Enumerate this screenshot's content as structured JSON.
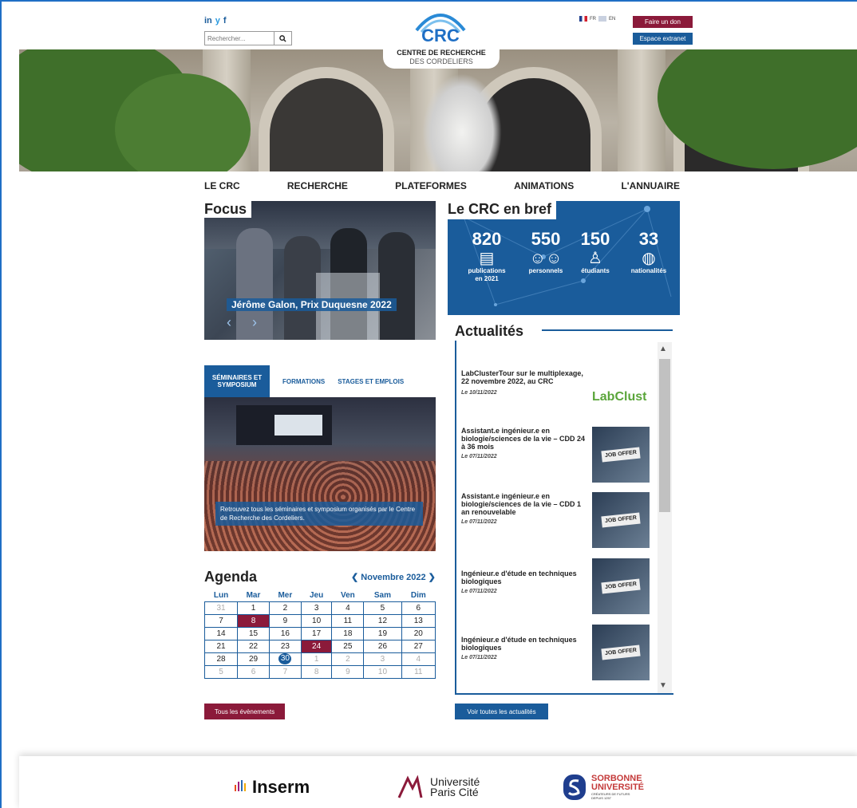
{
  "header": {
    "social": [
      "in",
      "y",
      "f"
    ],
    "search_placeholder": "Rechercher...",
    "logo_acronym": "CRC",
    "logo_line1": "CENTRE DE RECHERCHE",
    "logo_line2": "DES CORDELIERS",
    "lang_fr": "FR",
    "lang_en": "EN",
    "donate_label": "Faire un don",
    "extranet_label": "Espace extranet"
  },
  "nav": [
    "LE CRC",
    "RECHERCHE",
    "PLATEFORMES",
    "ANIMATIONS",
    "L'ANNUAIRE"
  ],
  "focus": {
    "title": "Focus",
    "caption": "Jérôme Galon, Prix Duquesne 2022",
    "prev": "‹",
    "next": "›"
  },
  "bref": {
    "title": "Le CRC en bref",
    "stats": [
      {
        "number": "820",
        "label": "publications en 2021",
        "icon": "document-icon"
      },
      {
        "number": "550",
        "label": "personnels",
        "icon": "people-icon"
      },
      {
        "number": "150",
        "label": "étudiants",
        "icon": "student-icon"
      },
      {
        "number": "33",
        "label": "nationalités",
        "icon": "globe-icon"
      }
    ]
  },
  "tabs": {
    "active": "SÉMINAIRES ET SYMPOSIUM",
    "t2": "FORMATIONS",
    "t3": "STAGES ET EMPLOIS",
    "caption": "Retrouvez tous les séminaires et symposium organisés par le Centre de Recherche des Cordeliers."
  },
  "agenda": {
    "title": "Agenda",
    "month": "Novembre 2022",
    "days": [
      "Lun",
      "Mar",
      "Mer",
      "Jeu",
      "Ven",
      "Sam",
      "Dim"
    ],
    "weeks": [
      [
        "31",
        "1",
        "2",
        "3",
        "4",
        "5",
        "6"
      ],
      [
        "7",
        "8",
        "9",
        "10",
        "11",
        "12",
        "13"
      ],
      [
        "14",
        "15",
        "16",
        "17",
        "18",
        "19",
        "20"
      ],
      [
        "21",
        "22",
        "23",
        "24",
        "25",
        "26",
        "27"
      ],
      [
        "28",
        "29",
        "30",
        "1",
        "2",
        "3",
        "4"
      ],
      [
        "5",
        "6",
        "7",
        "8",
        "9",
        "10",
        "11"
      ]
    ],
    "highlighted": [
      "8",
      "24"
    ],
    "today": "30",
    "all_events": "Tous les évènements"
  },
  "news": {
    "title": "Actualités",
    "items": [
      {
        "title": "LabClusterTour sur le multiplexage, 22 novembre 2022, au CRC",
        "date": "Le 10/11/2022",
        "image": "LabClust"
      },
      {
        "title": "Assistant.e ingénieur.e en biologie/sciences de la vie – CDD 24 à 36 mois",
        "date": "Le 07/11/2022",
        "image": "JOB OFFER"
      },
      {
        "title": "Assistant.e ingénieur.e en biologie/sciences de la vie – CDD 1 an renouvelable",
        "date": "Le 07/11/2022",
        "image": "JOB OFFER"
      },
      {
        "title": "Ingénieur.e d'étude en techniques biologiques",
        "date": "Le 07/11/2022",
        "image": "JOB OFFER"
      },
      {
        "title": "Ingénieur.e d'étude en techniques biologiques",
        "date": "Le 07/11/2022",
        "image": "JOB OFFER"
      }
    ],
    "all_news": "Voir toutes les actualités"
  },
  "footer": {
    "inserm": "Inserm",
    "upc_line1": "Université",
    "upc_line2": "Paris Cité",
    "sorbonne_line1": "SORBONNE",
    "sorbonne_line2": "UNIVERSITÉ",
    "sorbonne_tag1": "CRÉATEURS DE FUTURS",
    "sorbonne_tag2": "DEPUIS 1257"
  },
  "colors": {
    "primary": "#1a5c9b",
    "accent": "#8b1a3a"
  }
}
